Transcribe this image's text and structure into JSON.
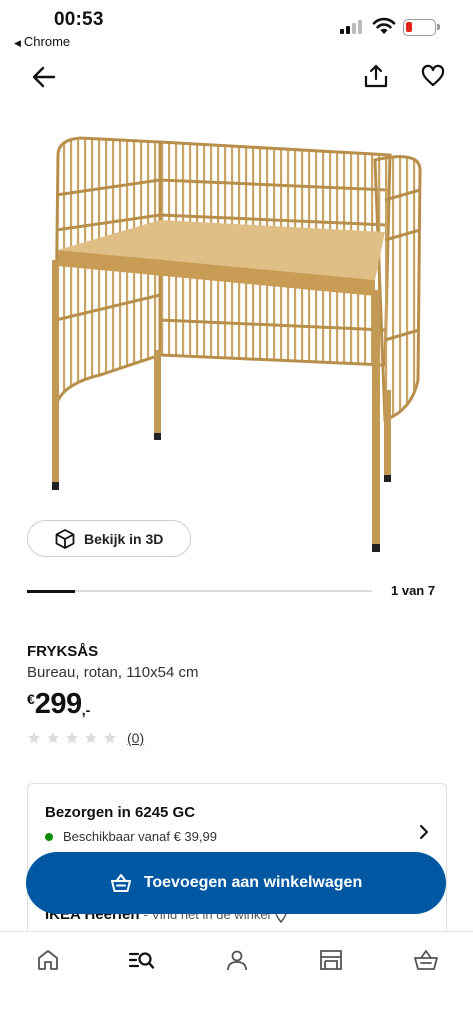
{
  "status_bar": {
    "time": "00:53",
    "back_app_label": "Chrome",
    "battery_color": "#e2231a"
  },
  "nav": {
    "back_icon": "arrow-left-icon",
    "share_icon": "share-icon",
    "favorite_icon": "heart-icon"
  },
  "product": {
    "image_name": "rattan-desk-image",
    "view_3d_label": "Bekijk in 3D",
    "gallery_counter": "1 van 7",
    "gallery_progress": 0.14,
    "name": "FRYKSÅS",
    "description": "Bureau, rotan, 110x54 cm",
    "price": {
      "currency": "€",
      "amount": "299",
      "suffix": ",-"
    },
    "rating": {
      "stars": 0,
      "max_stars": 5,
      "count_label": "(0)"
    }
  },
  "delivery": {
    "title": "Bezorgen in 6245 GC",
    "availability": "Beschikbaar vanaf € 39,99",
    "availability_color": "#0a8a00",
    "store_name": "IKEA Heerlen",
    "store_hint": "- Vind het in de winkel"
  },
  "cta": {
    "label": "Toevoegen aan winkelwagen",
    "color": "#0058a3"
  },
  "tabbar": {
    "items": [
      "home-icon",
      "search-list-icon",
      "profile-icon",
      "store-icon",
      "basket-icon"
    ],
    "active": "search-list-icon"
  }
}
